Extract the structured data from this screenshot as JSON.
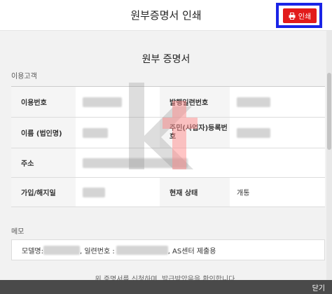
{
  "header": {
    "title": "원부증명서 인쇄",
    "print_label": "인쇄"
  },
  "document": {
    "title": "원부 증명서",
    "customer_section_label": "이용고객",
    "rows": [
      {
        "label_left": "이용번호",
        "value_left": "",
        "label_right": "발행일련번호",
        "value_right": ""
      },
      {
        "label_left": "이름 (법인명)",
        "value_left": "",
        "label_right": "주민(사업자)등록번호",
        "value_right": ""
      },
      {
        "label_left": "주소",
        "value_left": ""
      },
      {
        "label_left": "가입/해지일",
        "value_left": "",
        "label_right": "현재 상태",
        "value_right": "개통"
      }
    ],
    "memo_label": "메모",
    "memo": {
      "model_label": "모델명:",
      "serial_label": ", 일련번호 :",
      "suffix": ", AS센터 제출용"
    },
    "notice": "위 증명서를 신청하며, 발급받았음을 확인합니다.",
    "watermark": "kt"
  },
  "footer": {
    "close_label": "닫기"
  },
  "colors": {
    "highlight": "#1a24e6",
    "print_button": "#e21b1b",
    "footer": "#4a4a4a"
  }
}
